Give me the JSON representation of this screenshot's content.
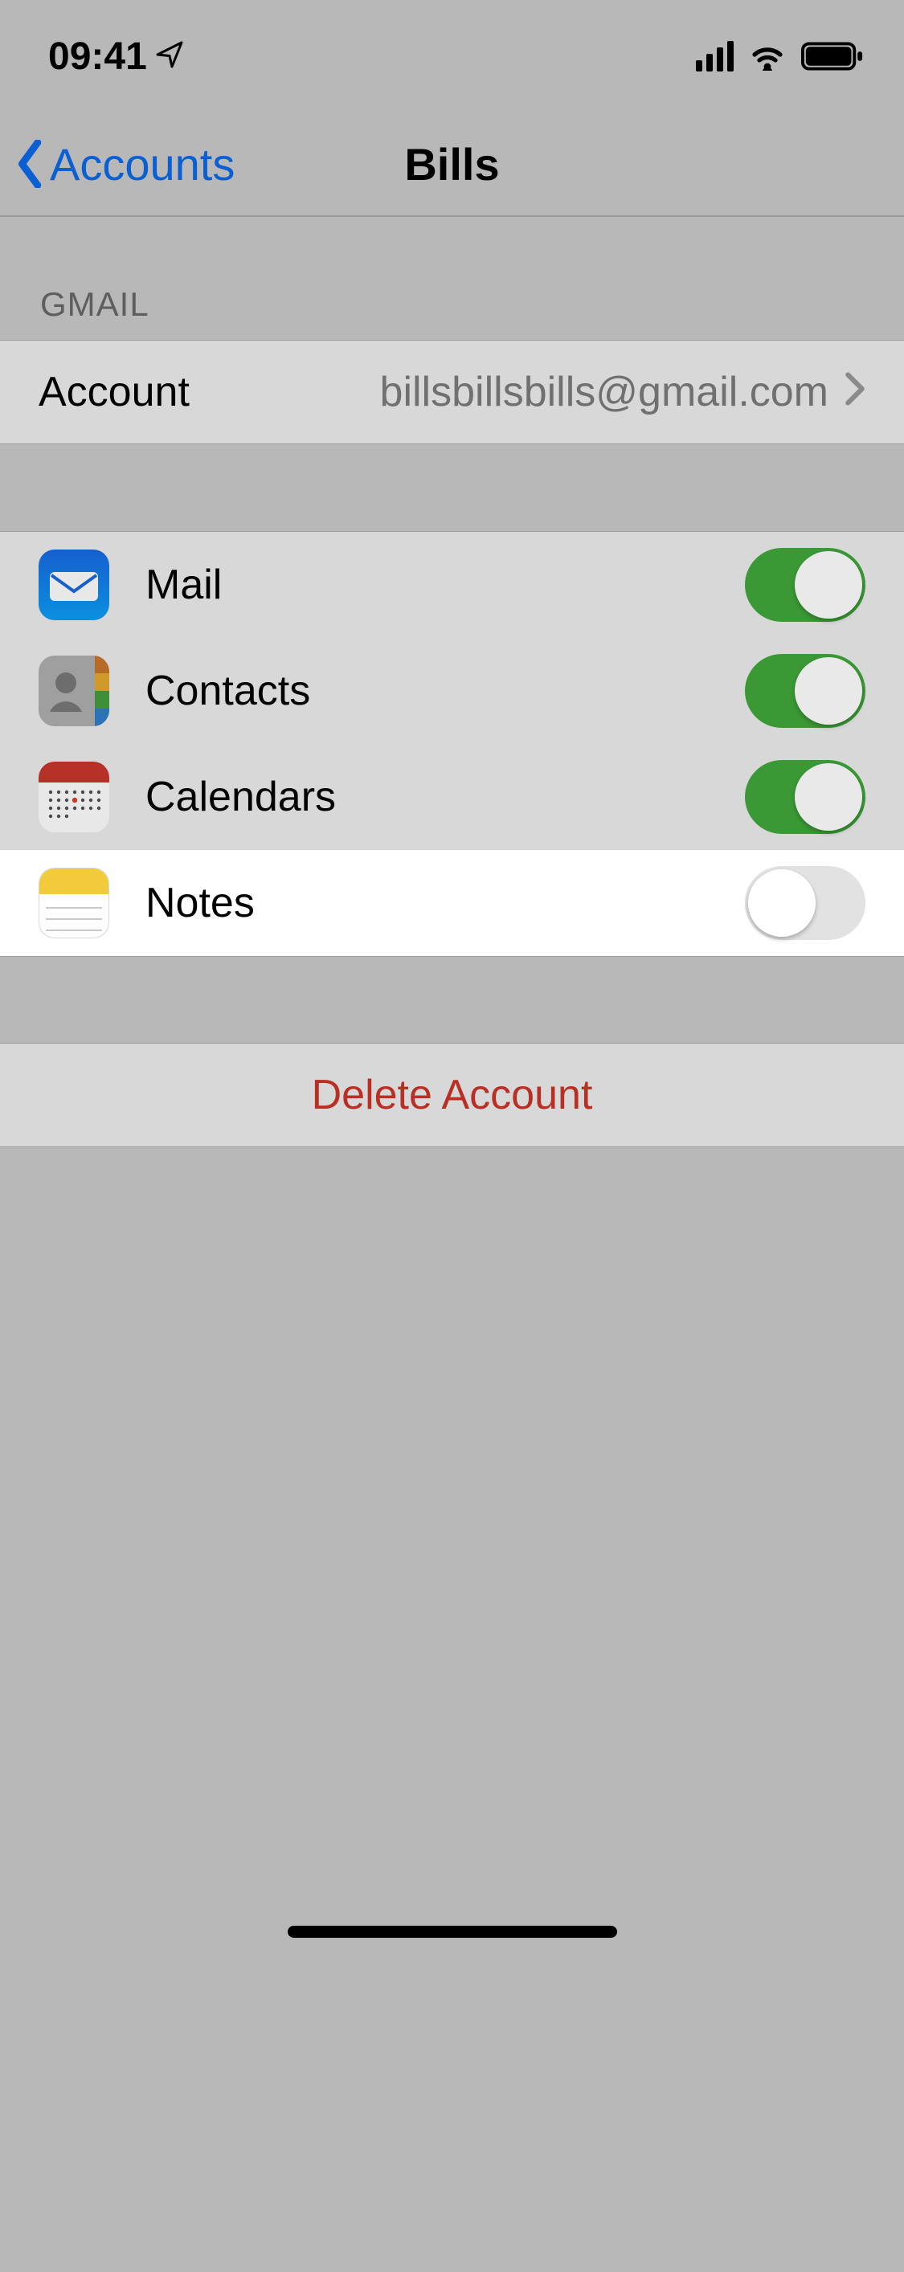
{
  "status": {
    "time": "09:41"
  },
  "nav": {
    "back_label": "Accounts",
    "title": "Bills"
  },
  "section1": {
    "header": "GMAIL",
    "account_label": "Account",
    "account_value": "billsbillsbills@gmail.com"
  },
  "services": [
    {
      "label": "Mail",
      "on": true,
      "highlighted": false,
      "icon": "mail"
    },
    {
      "label": "Contacts",
      "on": true,
      "highlighted": false,
      "icon": "contacts"
    },
    {
      "label": "Calendars",
      "on": true,
      "highlighted": false,
      "icon": "calendar"
    },
    {
      "label": "Notes",
      "on": false,
      "highlighted": true,
      "icon": "notes"
    }
  ],
  "delete_label": "Delete Account"
}
